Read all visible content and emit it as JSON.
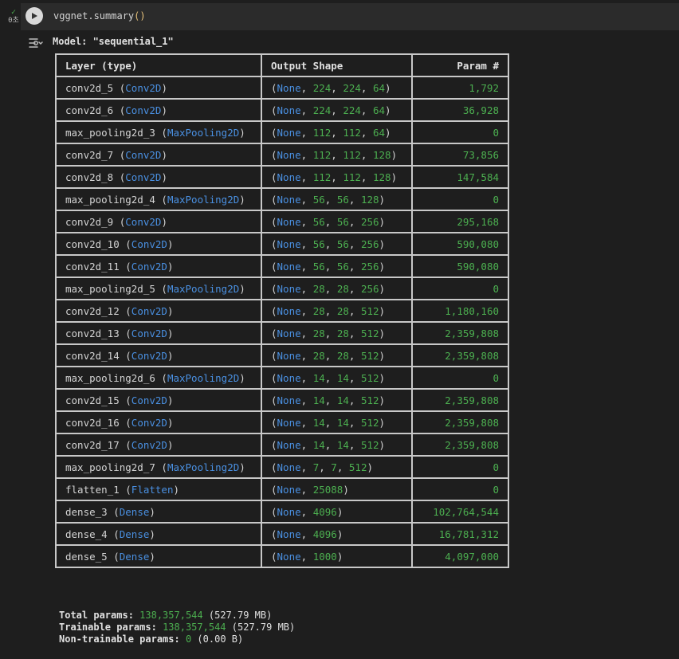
{
  "cell": {
    "status_text": "0초",
    "code_prefix": "vggnet.summary",
    "code_parens": "()"
  },
  "output": {
    "model_title": "Model: \"sequential_1\"",
    "headers": {
      "layer": "Layer (type)",
      "shape": "Output Shape",
      "param": "Param #"
    },
    "rows": [
      {
        "name": "conv2d_5",
        "type": "Conv2D",
        "shape": [
          "224",
          "224",
          "64"
        ],
        "param": "1,792"
      },
      {
        "name": "conv2d_6",
        "type": "Conv2D",
        "shape": [
          "224",
          "224",
          "64"
        ],
        "param": "36,928"
      },
      {
        "name": "max_pooling2d_3",
        "type": "MaxPooling2D",
        "shape": [
          "112",
          "112",
          "64"
        ],
        "param": "0"
      },
      {
        "name": "conv2d_7",
        "type": "Conv2D",
        "shape": [
          "112",
          "112",
          "128"
        ],
        "param": "73,856"
      },
      {
        "name": "conv2d_8",
        "type": "Conv2D",
        "shape": [
          "112",
          "112",
          "128"
        ],
        "param": "147,584"
      },
      {
        "name": "max_pooling2d_4",
        "type": "MaxPooling2D",
        "shape": [
          "56",
          "56",
          "128"
        ],
        "param": "0"
      },
      {
        "name": "conv2d_9",
        "type": "Conv2D",
        "shape": [
          "56",
          "56",
          "256"
        ],
        "param": "295,168"
      },
      {
        "name": "conv2d_10",
        "type": "Conv2D",
        "shape": [
          "56",
          "56",
          "256"
        ],
        "param": "590,080"
      },
      {
        "name": "conv2d_11",
        "type": "Conv2D",
        "shape": [
          "56",
          "56",
          "256"
        ],
        "param": "590,080"
      },
      {
        "name": "max_pooling2d_5",
        "type": "MaxPooling2D",
        "shape": [
          "28",
          "28",
          "256"
        ],
        "param": "0"
      },
      {
        "name": "conv2d_12",
        "type": "Conv2D",
        "shape": [
          "28",
          "28",
          "512"
        ],
        "param": "1,180,160"
      },
      {
        "name": "conv2d_13",
        "type": "Conv2D",
        "shape": [
          "28",
          "28",
          "512"
        ],
        "param": "2,359,808"
      },
      {
        "name": "conv2d_14",
        "type": "Conv2D",
        "shape": [
          "28",
          "28",
          "512"
        ],
        "param": "2,359,808"
      },
      {
        "name": "max_pooling2d_6",
        "type": "MaxPooling2D",
        "shape": [
          "14",
          "14",
          "512"
        ],
        "param": "0"
      },
      {
        "name": "conv2d_15",
        "type": "Conv2D",
        "shape": [
          "14",
          "14",
          "512"
        ],
        "param": "2,359,808"
      },
      {
        "name": "conv2d_16",
        "type": "Conv2D",
        "shape": [
          "14",
          "14",
          "512"
        ],
        "param": "2,359,808"
      },
      {
        "name": "conv2d_17",
        "type": "Conv2D",
        "shape": [
          "14",
          "14",
          "512"
        ],
        "param": "2,359,808"
      },
      {
        "name": "max_pooling2d_7",
        "type": "MaxPooling2D",
        "shape": [
          "7",
          "7",
          "512"
        ],
        "param": "0"
      },
      {
        "name": "flatten_1",
        "type": "Flatten",
        "shape": [
          "25088"
        ],
        "param": "0"
      },
      {
        "name": "dense_3",
        "type": "Dense",
        "shape": [
          "4096"
        ],
        "param": "102,764,544"
      },
      {
        "name": "dense_4",
        "type": "Dense",
        "shape": [
          "4096"
        ],
        "param": "16,781,312"
      },
      {
        "name": "dense_5",
        "type": "Dense",
        "shape": [
          "1000"
        ],
        "param": "4,097,000"
      }
    ],
    "totals": {
      "total_label": "Total params:",
      "total_value": "138,357,544",
      "total_size": "(527.79 MB)",
      "trainable_label": "Trainable params:",
      "trainable_value": "138,357,544",
      "trainable_size": "(527.79 MB)",
      "nontrainable_label": "Non-trainable params:",
      "nontrainable_value": "0",
      "nontrainable_size": "(0.00 B)"
    }
  },
  "colors": {
    "type": "#4a90e2",
    "number": "#4caf50",
    "background": "#1e1e1e"
  },
  "icons": {
    "run": "play-icon",
    "output": "output-settings-icon",
    "status": "check-icon"
  }
}
